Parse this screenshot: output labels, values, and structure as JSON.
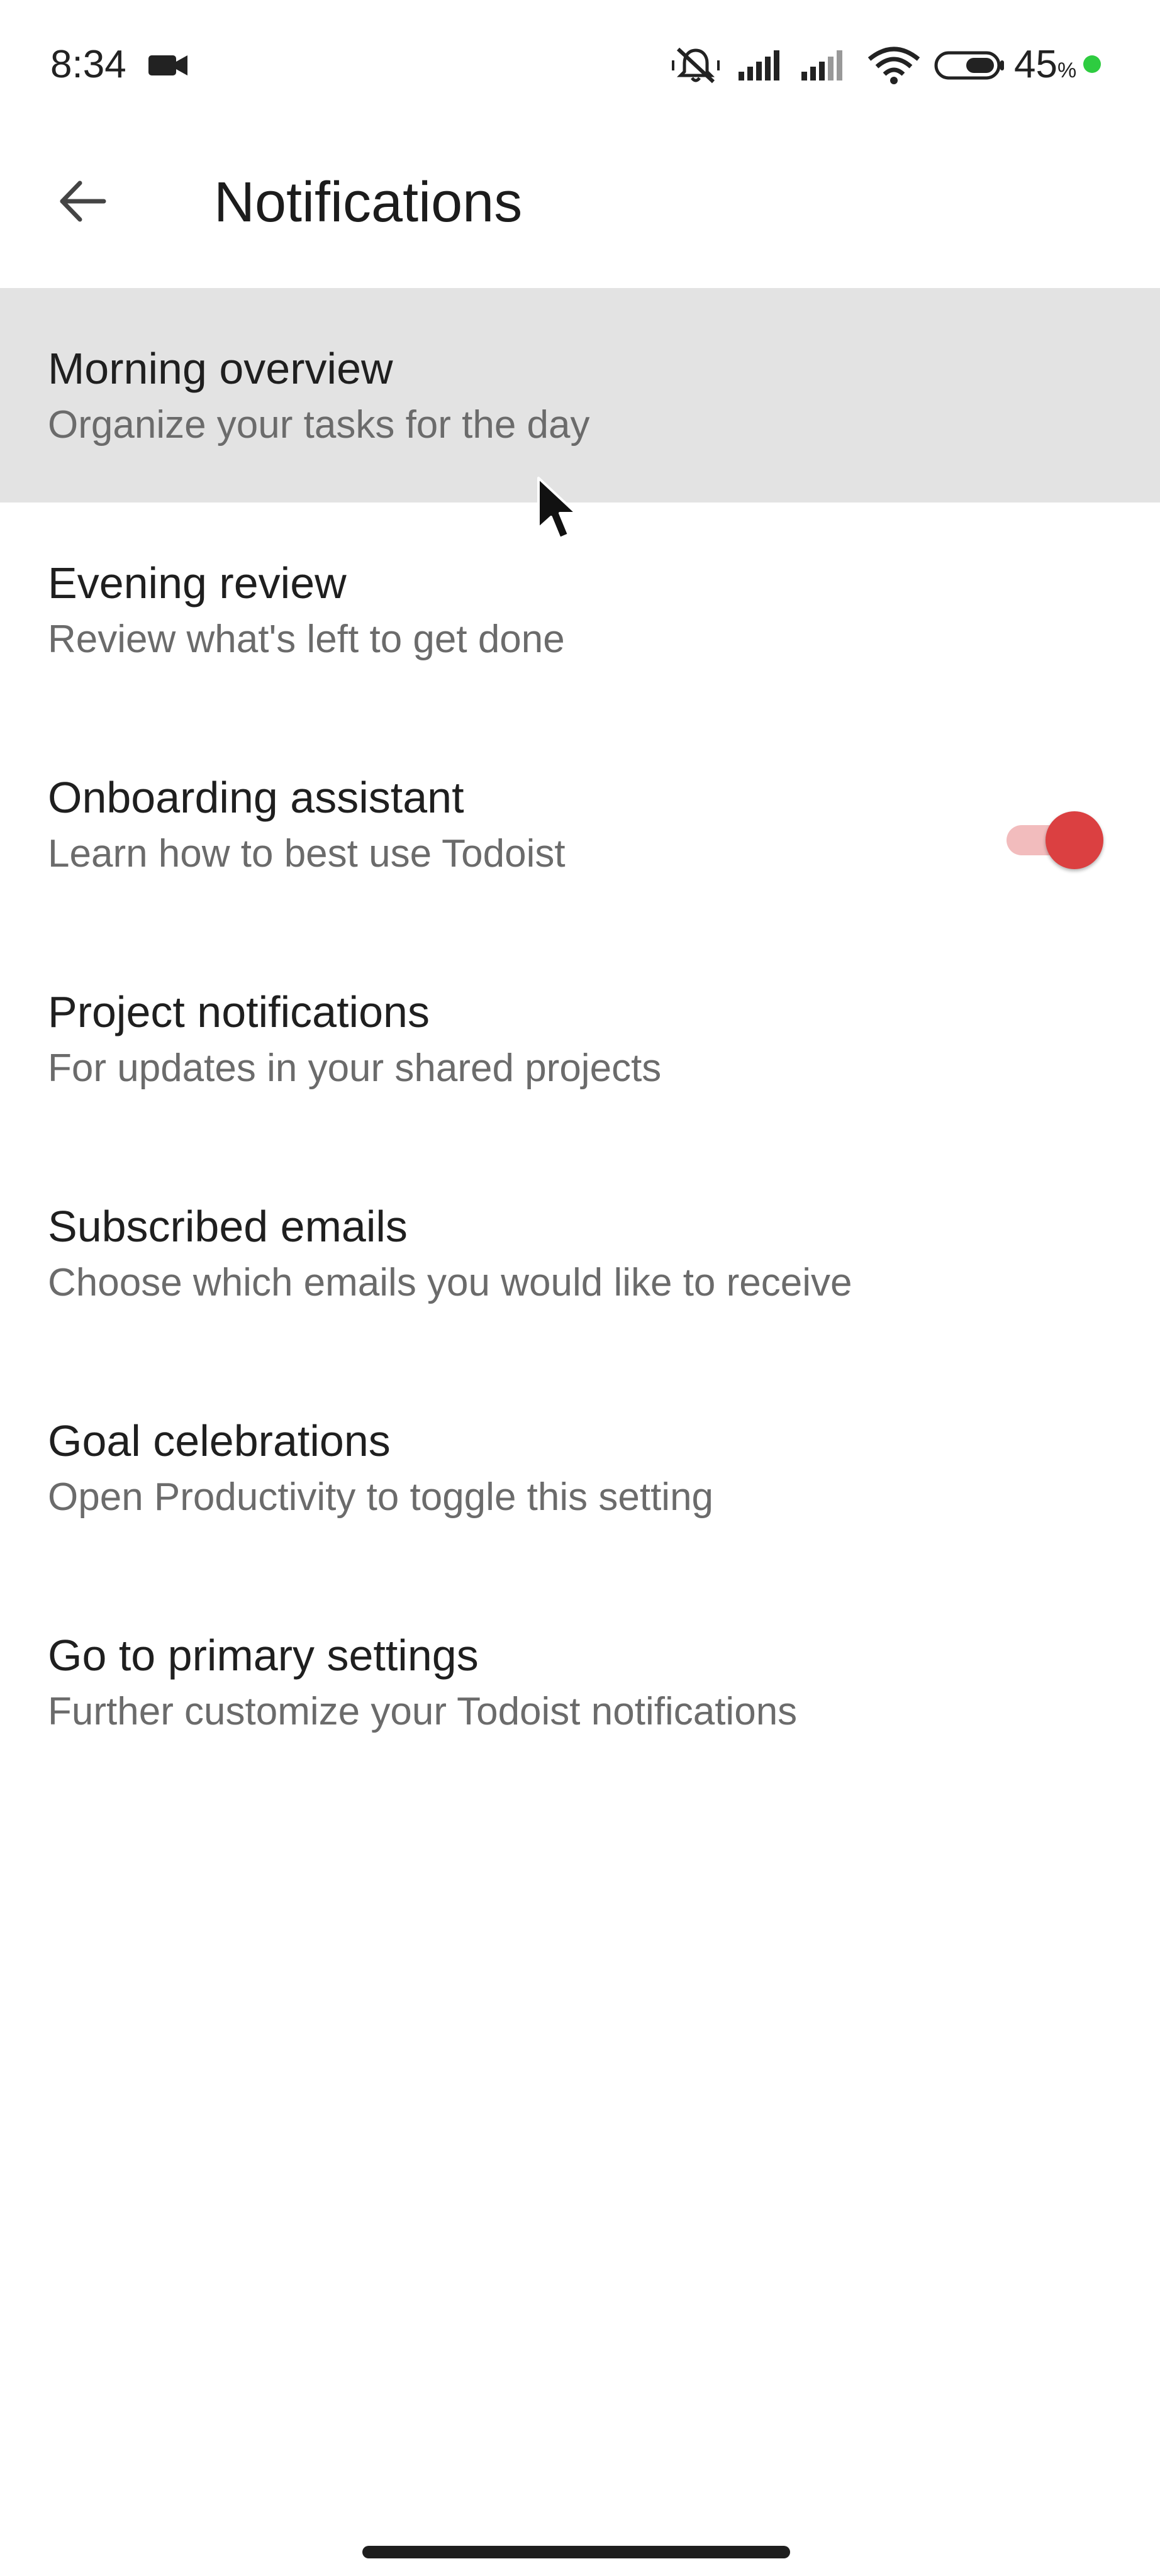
{
  "status_bar": {
    "time": "8:34",
    "battery_percent": "45",
    "battery_unit": "%",
    "battery_level": 0.45,
    "icons": [
      "video-camera-icon",
      "muted-bell-icon",
      "signal-icon",
      "signal-icon",
      "wifi-icon",
      "battery-icon"
    ],
    "charge_dot_color": "#2ecc40"
  },
  "header": {
    "title": "Notifications",
    "back_icon": "arrow-left-icon"
  },
  "settings": {
    "items": [
      {
        "title": "Morning overview",
        "subtitle": "Organize your tasks for the day",
        "highlighted": true
      },
      {
        "title": "Evening review",
        "subtitle": "Review what's left to get done"
      },
      {
        "title": "Onboarding assistant",
        "subtitle": "Learn how to best use Todoist",
        "toggle_on": true
      },
      {
        "title": "Project notifications",
        "subtitle": "For updates in your shared projects"
      },
      {
        "title": "Subscribed emails",
        "subtitle": "Choose which emails you would like to receive"
      },
      {
        "title": "Goal celebrations",
        "subtitle": "Open Productivity to toggle this setting"
      },
      {
        "title": "Go to primary settings",
        "subtitle": "Further customize your Todoist notifications"
      }
    ]
  },
  "colors": {
    "accent": "#db4041",
    "highlight_bg": "#e3e3e3",
    "text_primary": "#1f1f1f",
    "text_secondary": "#6b6b6b"
  }
}
